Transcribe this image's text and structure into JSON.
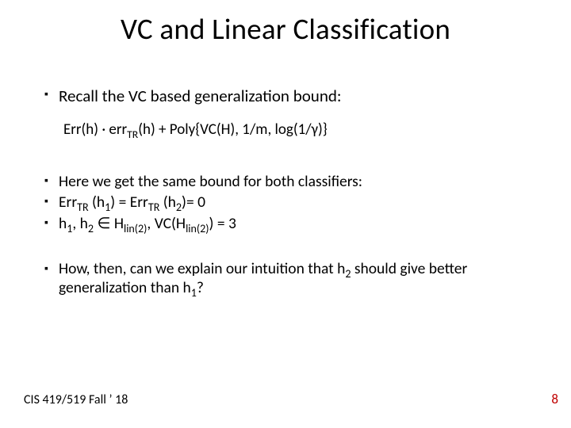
{
  "title": "VC and Linear Classification",
  "b1": "Recall the VC based generalization bound:",
  "formula_pre": "Err(h) · err",
  "formula_sub": "TR",
  "formula_post": "(h) + Poly{VC(H), 1/m, log(1/γ)}",
  "b2": "Here we get the same bound for both classifiers:",
  "b3_pre": "Err",
  "b3_tr": "TR",
  "b3_mid1": " (h",
  "b3_one": "1",
  "b3_mid2": ") = Err",
  "b3_mid3": " (h",
  "b3_two": "2",
  "b3_end": ")= 0",
  "b4_a": "h",
  "b4_1": "1",
  "b4_b": ", h",
  "b4_2": "2",
  "b4_c": " ∈ H",
  "b4_lin": "lin(2)",
  "b4_d": ", VC(H",
  "b4_e": ") =  3",
  "b5_a": "How, then, can we explain our intuition that h",
  "b5_2": "2",
  "b5_b": " should give better generalization than h",
  "b5_1": "1",
  "b5_c": "?",
  "footer_left": "CIS 419/519 Fall ’ 18",
  "footer_right": "8"
}
